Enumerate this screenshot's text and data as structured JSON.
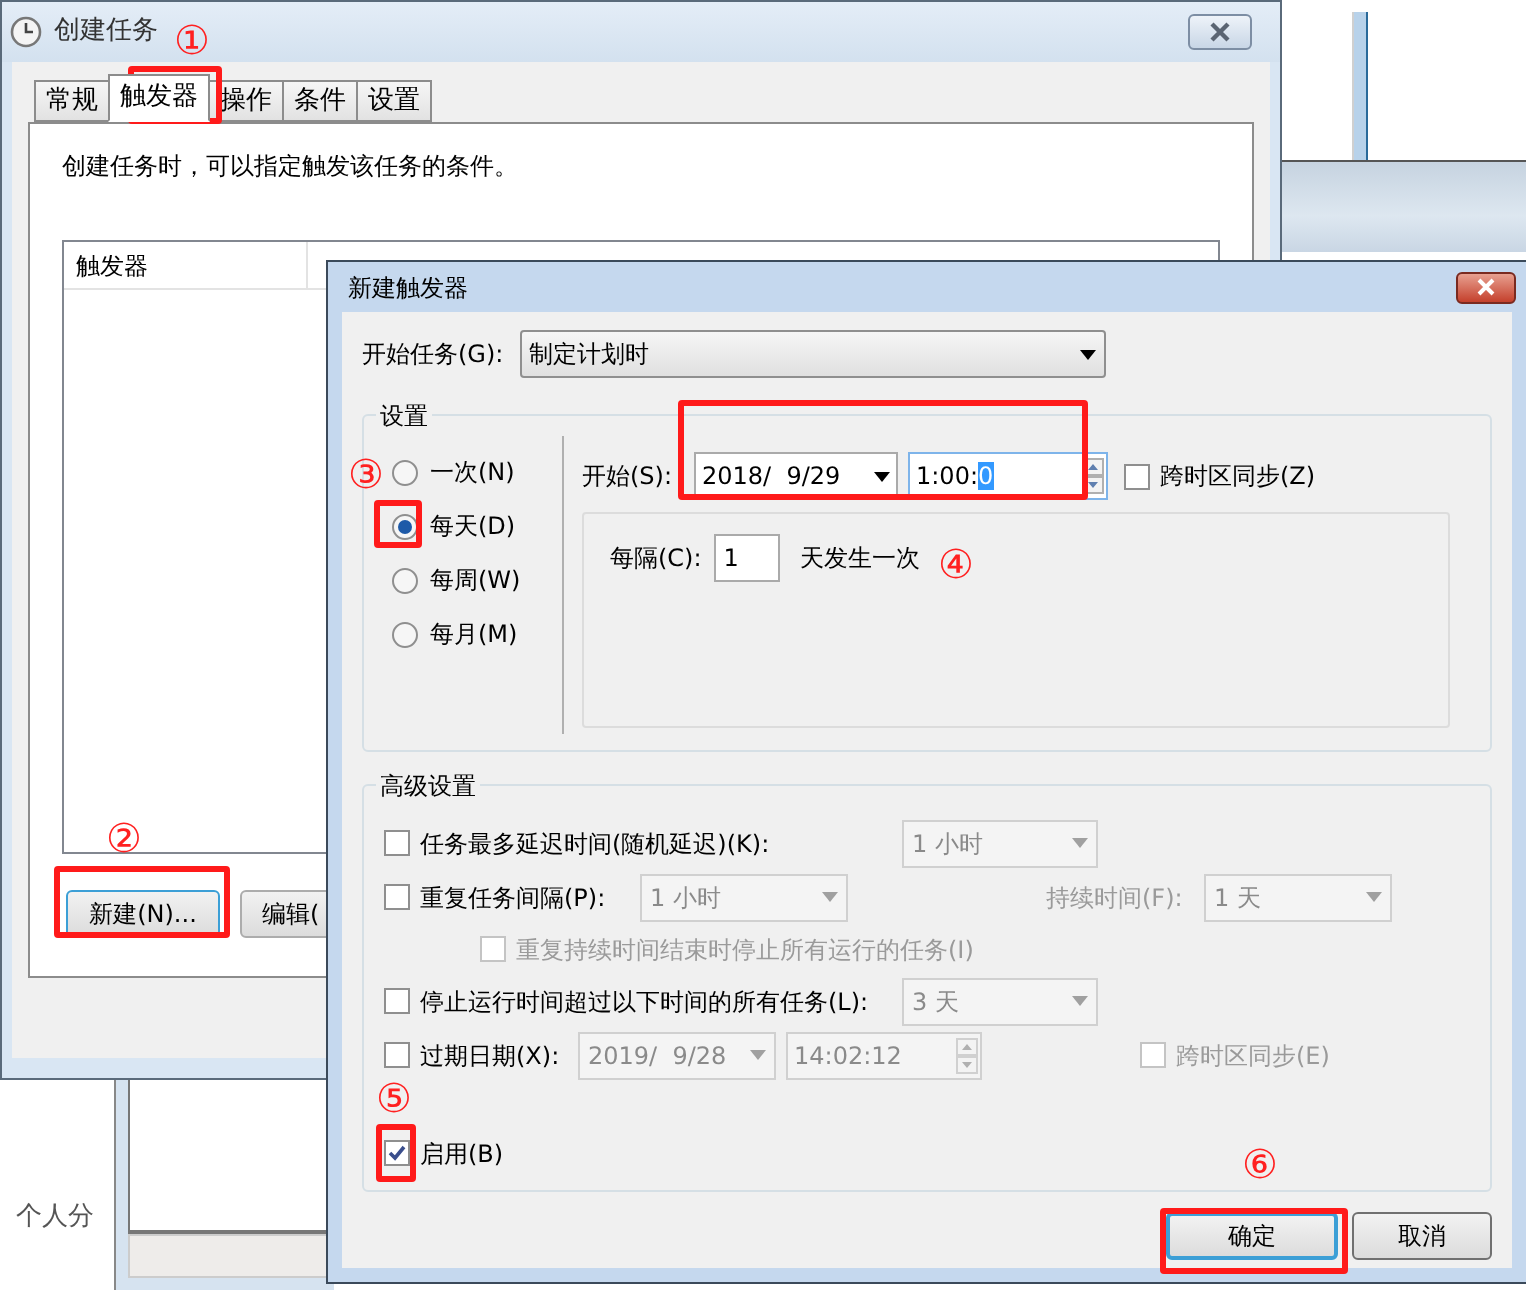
{
  "background": {
    "sidebar_text": "个人分"
  },
  "main_window": {
    "title": "创建任务",
    "tabs": [
      {
        "label": "常规",
        "selected": false
      },
      {
        "label": "触发器",
        "selected": true
      },
      {
        "label": "操作",
        "selected": false
      },
      {
        "label": "条件",
        "selected": false
      },
      {
        "label": "设置",
        "selected": false
      }
    ],
    "description": "创建任务时，可以指定触发该任务的条件。",
    "table": {
      "columns": [
        "触发器"
      ]
    },
    "buttons": [
      "新建(N)...",
      "编辑("
    ]
  },
  "dialog": {
    "title": "新建触发器",
    "start_task": {
      "label": "开始任务(G):",
      "value": "制定计划时"
    },
    "settings": {
      "title": "设置",
      "schedules": [
        {
          "label": "一次(N)",
          "selected": false
        },
        {
          "label": "每天(D)",
          "selected": true
        },
        {
          "label": "每周(W)",
          "selected": false
        },
        {
          "label": "每月(M)",
          "selected": false
        }
      ],
      "start_label": "开始(S):",
      "date": "2018/  9/29",
      "time": "1:00:",
      "time_selected": "0",
      "sync": {
        "label": "跨时区同步(Z)",
        "checked": false
      },
      "recur_label": "每隔(C):",
      "recur_value": "1",
      "recur_suffix": "天发生一次"
    },
    "advanced": {
      "title": "高级设置",
      "rows": [
        {
          "kind": "select",
          "label": "任务最多延迟时间(随机延迟)(K):",
          "checked": false,
          "select": {
            "value": "1 小时",
            "disabled": true
          }
        },
        {
          "kind": "repeat",
          "label": "重复任务间隔(P):",
          "checked": false,
          "select": {
            "value": "1 小时",
            "disabled": true
          },
          "duration_label": "持续时间(F):",
          "duration": {
            "value": "1 天",
            "disabled": true
          }
        },
        {
          "kind": "sub",
          "label": "重复持续时间结束时停止所有运行的任务(I)",
          "checked": false,
          "disabled": true
        },
        {
          "kind": "select",
          "label": "停止运行时间超过以下时间的所有任务(L):",
          "checked": false,
          "select": {
            "value": "3 天",
            "disabled": true
          }
        },
        {
          "kind": "expire",
          "label": "过期日期(X):",
          "checked": false,
          "date": {
            "value": "2019/  9/28",
            "disabled": true
          },
          "time": {
            "value": "14:02:12",
            "disabled": true
          },
          "sync": {
            "label": "跨时区同步(E)",
            "checked": false,
            "disabled": true
          }
        },
        {
          "kind": "check",
          "label": "启用(B)",
          "checked": true
        }
      ]
    },
    "buttons": [
      {
        "label": "确定",
        "default": true
      },
      {
        "label": "取消",
        "default": false
      }
    ]
  },
  "annotations": [
    {
      "label": "①"
    },
    {
      "label": "②"
    },
    {
      "label": "③"
    },
    {
      "label": "④"
    },
    {
      "label": "⑤"
    },
    {
      "label": "⑥"
    }
  ]
}
